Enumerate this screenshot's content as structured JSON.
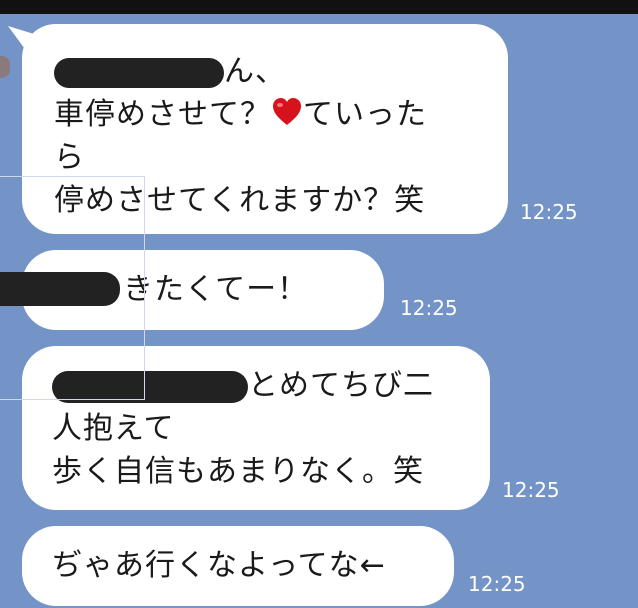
{
  "messages": [
    {
      "lines": [
        "ん、",
        "車停めさせて？",
        "ていった",
        "ら",
        "停めさせてくれますか？笑"
      ],
      "time": "12:25"
    },
    {
      "text": "いきたくてー！",
      "time": "12:25"
    },
    {
      "lines": [
        "とめてちび二",
        "人抱えて",
        "歩く自信もあまりなく。笑"
      ],
      "time": "12:25"
    },
    {
      "text": "ぢゃあ行くなよってな←",
      "time": "12:25"
    }
  ],
  "icons": {
    "heart": "red-heart-emoji"
  },
  "colors": {
    "background": "#7494c8",
    "bubble": "#ffffff",
    "highlight": "#f2e600",
    "redaction": "#222222"
  }
}
